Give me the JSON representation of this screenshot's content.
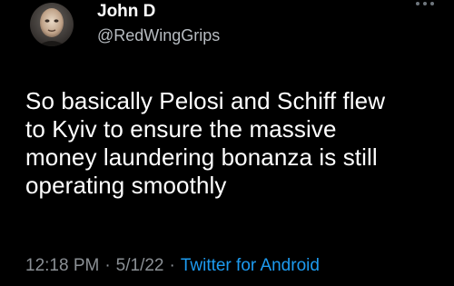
{
  "author": {
    "display_name": "John D",
    "handle": "@RedWingGrips",
    "avatar_icon": "profile-photo-icon"
  },
  "menu": {
    "more_icon": "more-horizontal-icon"
  },
  "tweet": {
    "text_lines": [
      "So basically Pelosi and Schiff flew",
      "to Kyiv to ensure the massive",
      "money laundering bonanza is still",
      "operating smoothly"
    ]
  },
  "meta": {
    "time": "12:18 PM",
    "date": "5/1/22",
    "separator": "·",
    "source": "Twitter for Android"
  },
  "colors": {
    "background": "#000000",
    "text": "#ffffff",
    "muted": "#8b9095",
    "link": "#1d9bf0"
  }
}
